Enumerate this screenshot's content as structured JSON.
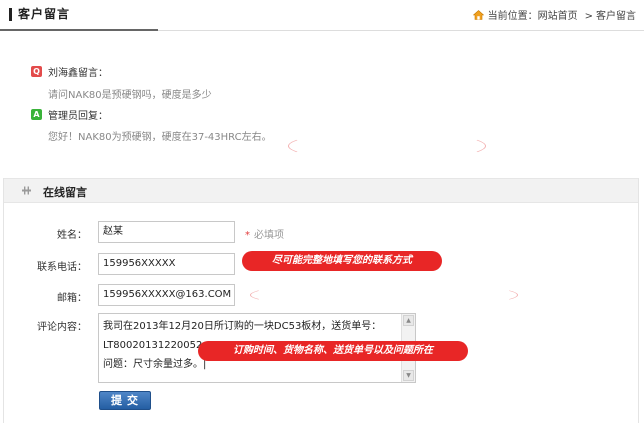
{
  "header": {
    "title": "客户留言",
    "breadcrumb_prefix": "当前位置：",
    "breadcrumb_items": [
      "网站首页",
      "客户留言"
    ],
    "breadcrumb_separator": ">"
  },
  "message": {
    "question_badge": "Q",
    "asker_label": "刘海鑫留言：",
    "question": "请问NAK80是预硬钢吗，硬度是多少",
    "answer_badge": "A",
    "replier_label": "管理员回复：",
    "answer": "您好！NAK80为预硬钢，硬度在37-43HRC左右。"
  },
  "form": {
    "section_title": "在线留言",
    "name_label": "姓名：",
    "name_value": "赵某",
    "required_star": "*",
    "required_hint": "必填项",
    "phone_label": "联系电话：",
    "phone_value": "159956XXXXX",
    "email_label": "邮箱：",
    "email_value": "159956XXXXX@163.COM",
    "comment_label": "评论内容：",
    "comment_value": "我司在2013年12月20日所订购的一块DC53板材，送货单号：\nLT80020131220052\n问题：尺寸余量过多。|",
    "submit_label": "提交"
  },
  "tips": {
    "contact_tip": "尽可能完整地填写您的联系方式",
    "comment_tip": "订购时间、货物名称、送货单号以及问题所在"
  },
  "colors": {
    "tip_red": "#e82626",
    "question_badge": "#e34b4b",
    "answer_badge": "#3ab33a",
    "button_blue": "#245ea3"
  }
}
